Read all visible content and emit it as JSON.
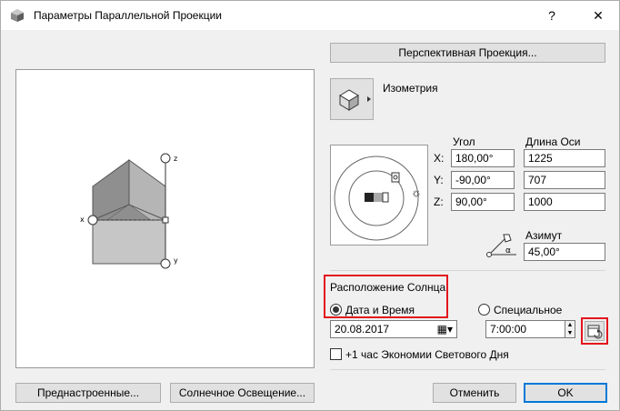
{
  "window": {
    "title": "Параметры Параллельной Проекции",
    "help_label": "?",
    "close_label": "✕"
  },
  "perspective_button_label": "Перспективная Проекция...",
  "projection": {
    "name": "Изометрия"
  },
  "preview": {
    "axis_x": "x",
    "axis_y": "y",
    "axis_z": "z"
  },
  "angles": {
    "header_angle": "Угол",
    "header_axis_length": "Длина Оси",
    "rows": [
      {
        "axis": "X:",
        "angle": "180,00°",
        "length": "1225"
      },
      {
        "axis": "Y:",
        "angle": "-90,00°",
        "length": "707"
      },
      {
        "axis": "Z:",
        "angle": "90,00°",
        "length": "1000"
      }
    ]
  },
  "azimuth": {
    "label": "Азимут",
    "value": "45,00°",
    "alpha_symbol": "α"
  },
  "sun": {
    "section_label": "Расположение Солнца:",
    "option_date_time": "Дата и Время",
    "option_custom": "Специальное",
    "date_value": "20.08.2017",
    "time_value": "7:00:00",
    "dst_label": "+1 час Экономии Светового Дня",
    "selected": "date_time",
    "dst_checked": false
  },
  "buttons": {
    "presets": "Преднастроенные...",
    "sun_lighting": "Солнечное Освещение...",
    "cancel": "Отменить",
    "ok": "OK"
  },
  "colors": {
    "highlight": "#e3141d",
    "accent": "#0078d7"
  }
}
